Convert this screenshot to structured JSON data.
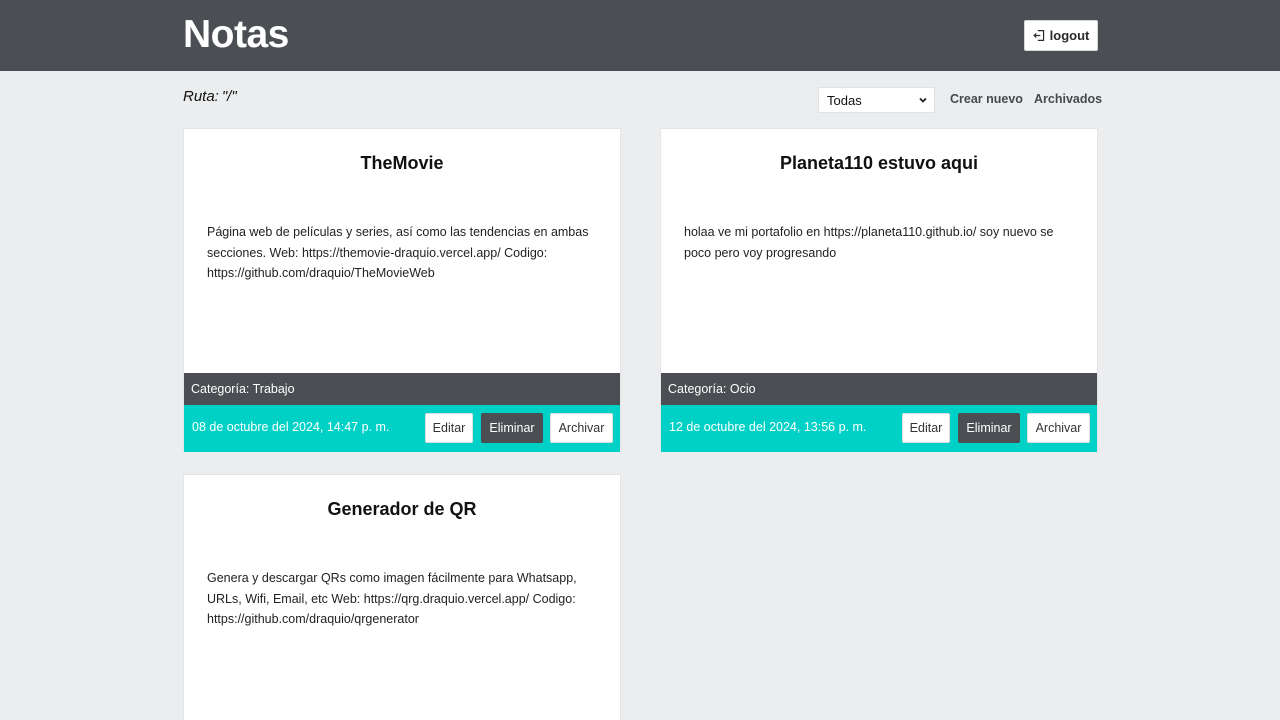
{
  "header": {
    "title": "Notas",
    "logout_label": "logout"
  },
  "toolbar": {
    "route_label": "Ruta:",
    "route_value": "\"/\"",
    "filter": {
      "selected": "Todas"
    },
    "create_label": "Crear nuevo",
    "archived_label": "Archivados"
  },
  "notes": [
    {
      "title": "TheMovie",
      "body": "Página web de películas y series, así como las tendencias en ambas secciones. Web: https://themovie-draquio.vercel.app/ Codigo: https://github.com/draquio/TheMovieWeb",
      "category": "Categoría: Trabajo",
      "date": "08 de octubre del 2024, 14:47 p. m.",
      "edit_label": "Editar",
      "delete_label": "Eliminar",
      "archive_label": "Archivar"
    },
    {
      "title": "Planeta110 estuvo aqui",
      "body": "holaa ve mi portafolio en https://planeta110.github.io/ soy nuevo se poco pero voy progresando",
      "category": "Categoría: Ocio",
      "date": "12 de octubre del 2024, 13:56 p. m.",
      "edit_label": "Editar",
      "delete_label": "Eliminar",
      "archive_label": "Archivar"
    },
    {
      "title": "Generador de QR",
      "body": "Genera y descargar QRs como imagen fácilmente para Whatsapp, URLs, Wifi, Email, etc Web: https://qrg.draquio.vercel.app/ Codigo: https://github.com/draquio/qrgenerator"
    }
  ],
  "colors": {
    "header_bg": "#4b4e53",
    "accent": "#00d1c7",
    "page_bg": "#ebedee"
  }
}
